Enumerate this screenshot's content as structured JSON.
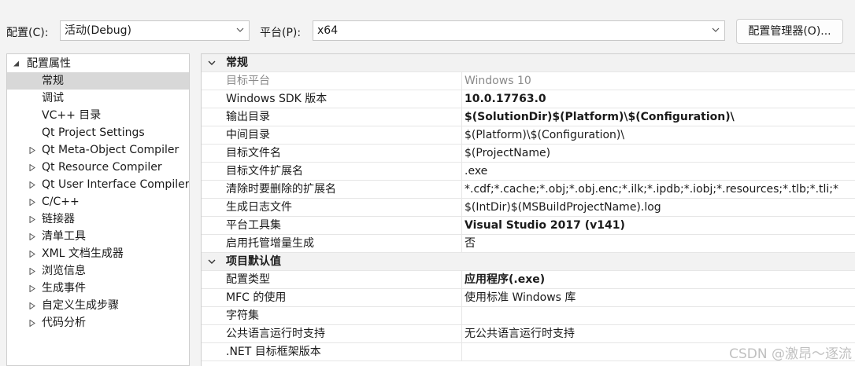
{
  "toolbar": {
    "config_label": "配置(C):",
    "config_value": "活动(Debug)",
    "platform_label": "平台(P):",
    "platform_value": "x64",
    "manager_button": "配置管理器(O)..."
  },
  "tree": {
    "root": "配置属性",
    "items": [
      {
        "label": "常规",
        "expandable": false,
        "selected": true
      },
      {
        "label": "调试",
        "expandable": false,
        "selected": false
      },
      {
        "label": "VC++ 目录",
        "expandable": false,
        "selected": false
      },
      {
        "label": "Qt Project Settings",
        "expandable": false,
        "selected": false
      },
      {
        "label": "Qt Meta-Object Compiler",
        "expandable": true,
        "selected": false
      },
      {
        "label": "Qt Resource Compiler",
        "expandable": true,
        "selected": false
      },
      {
        "label": "Qt User Interface Compiler",
        "expandable": true,
        "selected": false
      },
      {
        "label": "C/C++",
        "expandable": true,
        "selected": false
      },
      {
        "label": "链接器",
        "expandable": true,
        "selected": false
      },
      {
        "label": "清单工具",
        "expandable": true,
        "selected": false
      },
      {
        "label": "XML 文档生成器",
        "expandable": true,
        "selected": false
      },
      {
        "label": "浏览信息",
        "expandable": true,
        "selected": false
      },
      {
        "label": "生成事件",
        "expandable": true,
        "selected": false
      },
      {
        "label": "自定义生成步骤",
        "expandable": true,
        "selected": false
      },
      {
        "label": "代码分析",
        "expandable": true,
        "selected": false
      }
    ]
  },
  "grid": {
    "categories": [
      {
        "title": "常规",
        "rows": [
          {
            "name": "目标平台",
            "value": "Windows 10",
            "dim": true,
            "bold": false
          },
          {
            "name": "Windows SDK 版本",
            "value": "10.0.17763.0",
            "dim": false,
            "bold": true
          },
          {
            "name": "输出目录",
            "value": "$(SolutionDir)$(Platform)\\$(Configuration)\\",
            "dim": false,
            "bold": true
          },
          {
            "name": "中间目录",
            "value": "$(Platform)\\$(Configuration)\\",
            "dim": false,
            "bold": false
          },
          {
            "name": "目标文件名",
            "value": "$(ProjectName)",
            "dim": false,
            "bold": false
          },
          {
            "name": "目标文件扩展名",
            "value": ".exe",
            "dim": false,
            "bold": false
          },
          {
            "name": "清除时要删除的扩展名",
            "value": "*.cdf;*.cache;*.obj;*.obj.enc;*.ilk;*.ipdb;*.iobj;*.resources;*.tlb;*.tli;*",
            "dim": false,
            "bold": false
          },
          {
            "name": "生成日志文件",
            "value": "$(IntDir)$(MSBuildProjectName).log",
            "dim": false,
            "bold": false
          },
          {
            "name": "平台工具集",
            "value": "Visual Studio 2017 (v141)",
            "dim": false,
            "bold": true
          },
          {
            "name": "启用托管增量生成",
            "value": "否",
            "dim": false,
            "bold": false
          }
        ]
      },
      {
        "title": "项目默认值",
        "rows": [
          {
            "name": "配置类型",
            "value": "应用程序(.exe)",
            "dim": false,
            "bold": true
          },
          {
            "name": "MFC 的使用",
            "value": "使用标准 Windows 库",
            "dim": false,
            "bold": false
          },
          {
            "name": "字符集",
            "value": "",
            "dim": false,
            "bold": false
          },
          {
            "name": "公共语言运行时支持",
            "value": "无公共语言运行时支持",
            "dim": false,
            "bold": false
          },
          {
            "name": ".NET 目标框架版本",
            "value": "",
            "dim": false,
            "bold": false
          }
        ]
      }
    ]
  },
  "watermark": "CSDN @激昂～逐流",
  "colors": {
    "selected_bg": "#d8d8d8",
    "category_bg": "#f2f2f2",
    "dim_text": "#8a8a8a"
  }
}
